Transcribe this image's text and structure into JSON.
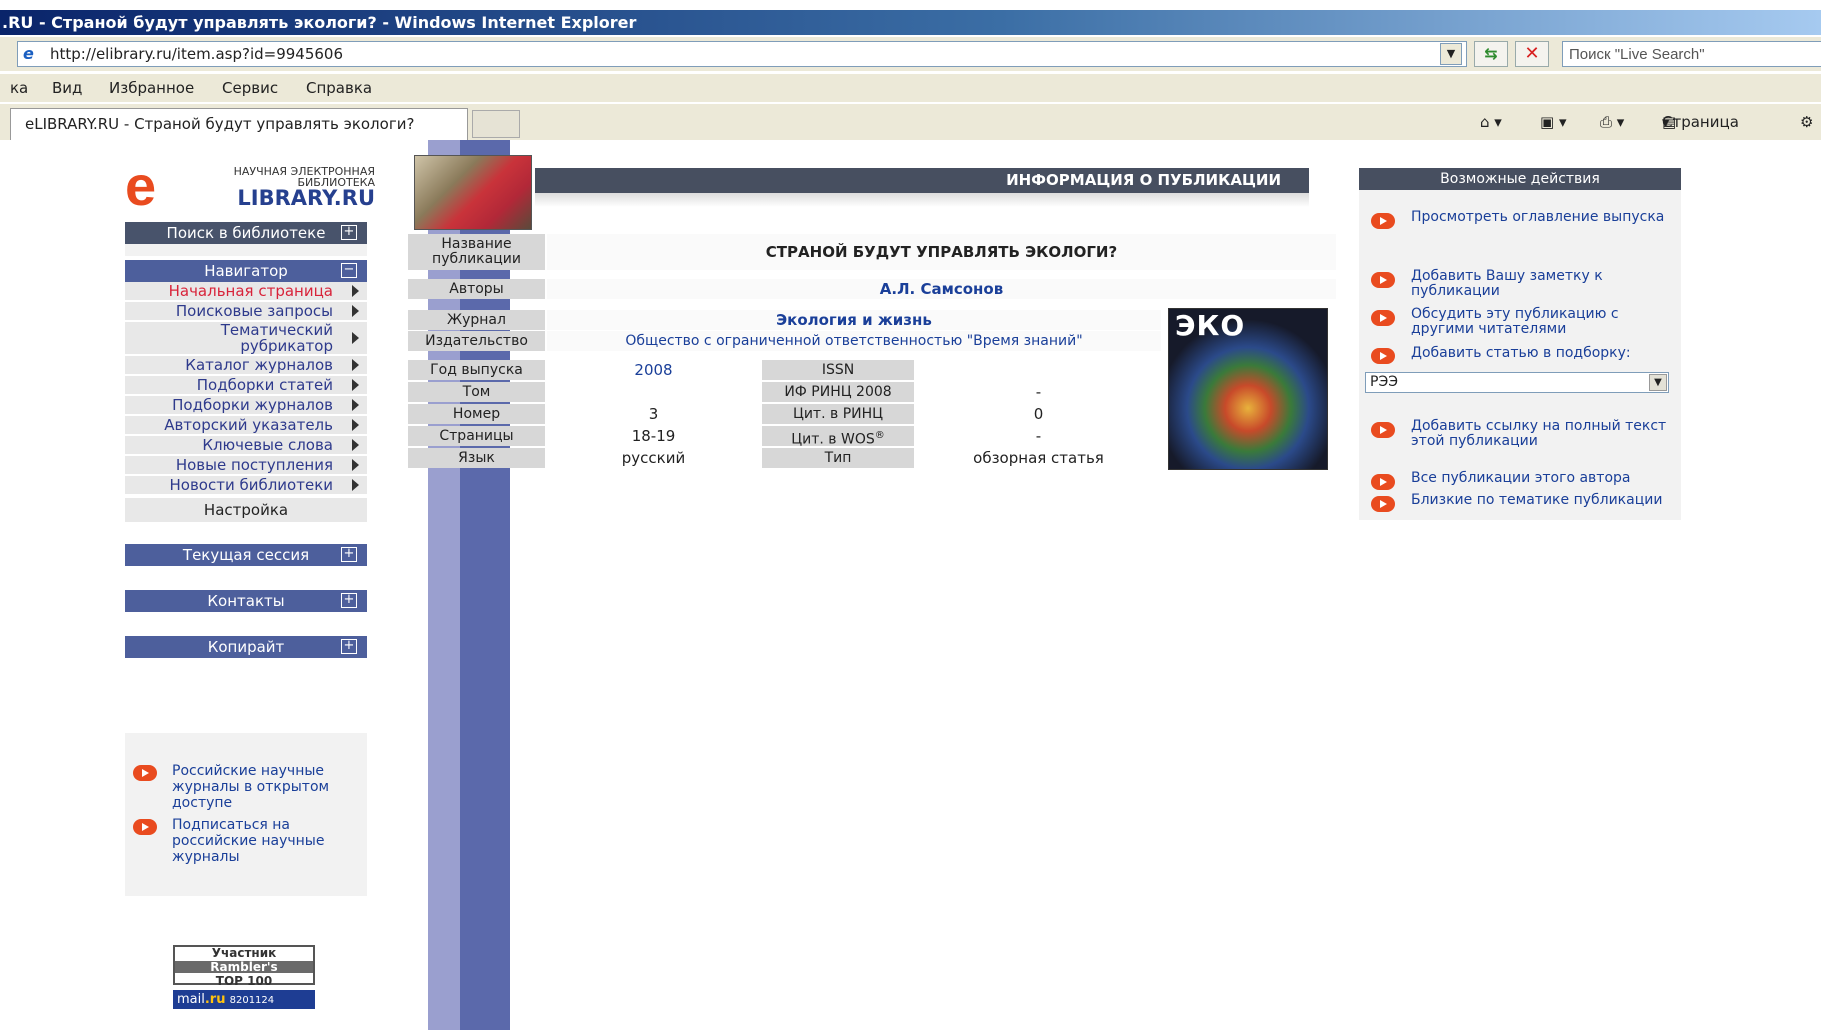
{
  "window": {
    "title": ".RU - Страной будут управлять экологи? - Windows Internet Explorer",
    "url": "http://elibrary.ru/item.asp?id=9945606",
    "live_search_placeholder": "Поиск \"Live Search\"",
    "menu": [
      "ка",
      "Вид",
      "Избранное",
      "Сервис",
      "Справка"
    ],
    "tab_title": "eLIBRARY.RU - Страной будут управлять экологи?",
    "page_menu_label": "Страница"
  },
  "logo": {
    "line1": "НАУЧНАЯ ЭЛЕКТРОННАЯ",
    "line2": "БИБЛИОТЕКА",
    "brand": "LIBRARY.RU",
    "brand_letter": "e"
  },
  "sidebar": {
    "search_header": "Поиск в библиотеке",
    "navigator_header": "Навигатор",
    "nav_items": [
      "Начальная страница",
      "Поисковые запросы",
      "Тематический рубрикатор",
      "Каталог журналов",
      "Подборки статей",
      "Подборки журналов",
      "Авторский указатель",
      "Ключевые слова",
      "Новые поступления",
      "Новости библиотеки"
    ],
    "settings": "Настройка",
    "session_header": "Текущая сессия",
    "contacts_header": "Контакты",
    "copyright_header": "Копирайт",
    "links": [
      "Российские научные журналы в открытом доступе",
      "Подписаться на российские научные журналы"
    ],
    "rambler": {
      "line1": "Участник",
      "line2": "Rambler's",
      "line3": "TOP 100"
    },
    "mailru": {
      "brand": "mail",
      "suffix": ".ru",
      "counter": "8201124"
    }
  },
  "publication": {
    "section_header": "ИНФОРМАЦИЯ О ПУБЛИКАЦИИ",
    "labels": {
      "title": "Название публикации",
      "authors": "Авторы",
      "journal": "Журнал",
      "publisher": "Издательство",
      "year": "Год выпуска",
      "issn": "ISSN",
      "volume": "Том",
      "rinc_if": "ИФ РИНЦ 2008",
      "number": "Номер",
      "rinc_cit": "Цит. в РИНЦ",
      "pages": "Страницы",
      "wos_cit": "Цит. в WOS",
      "wos_mark": "®",
      "language": "Язык",
      "type": "Тип"
    },
    "values": {
      "title": "СТРАНОЙ БУДУТ УПРАВЛЯТЬ ЭКОЛОГИ?",
      "authors": "А.Л. Самсонов",
      "journal": "Экология и жизнь",
      "publisher": "Общество с ограниченной ответственностью \"Время знаний\"",
      "year": "2008",
      "issn": "",
      "volume": "",
      "rinc_if": "-",
      "number": "3",
      "rinc_cit": "0",
      "pages": "18-19",
      "wos_cit": "-",
      "language": "русский",
      "type": "обзорная статья"
    },
    "cover_text": "ЭКО"
  },
  "actions": {
    "header": "Возможные действия",
    "items": [
      "Просмотреть оглавление выпуска",
      "Добавить Вашу заметку к публикации",
      "Обсудить эту публикацию с другими читателями",
      "Добавить статью в подборку:",
      "Добавить ссылку на полный текст этой публикации",
      "Все публикации этого автора",
      "Близкие по тематике публикации"
    ],
    "collection_select": "РЭЭ"
  },
  "colors": {
    "sidebar_header": "#48536b",
    "nav_header": "#4d5f9c",
    "link": "#1a3f99",
    "active_link": "#d8233a",
    "bullet": "#e94b1f"
  }
}
